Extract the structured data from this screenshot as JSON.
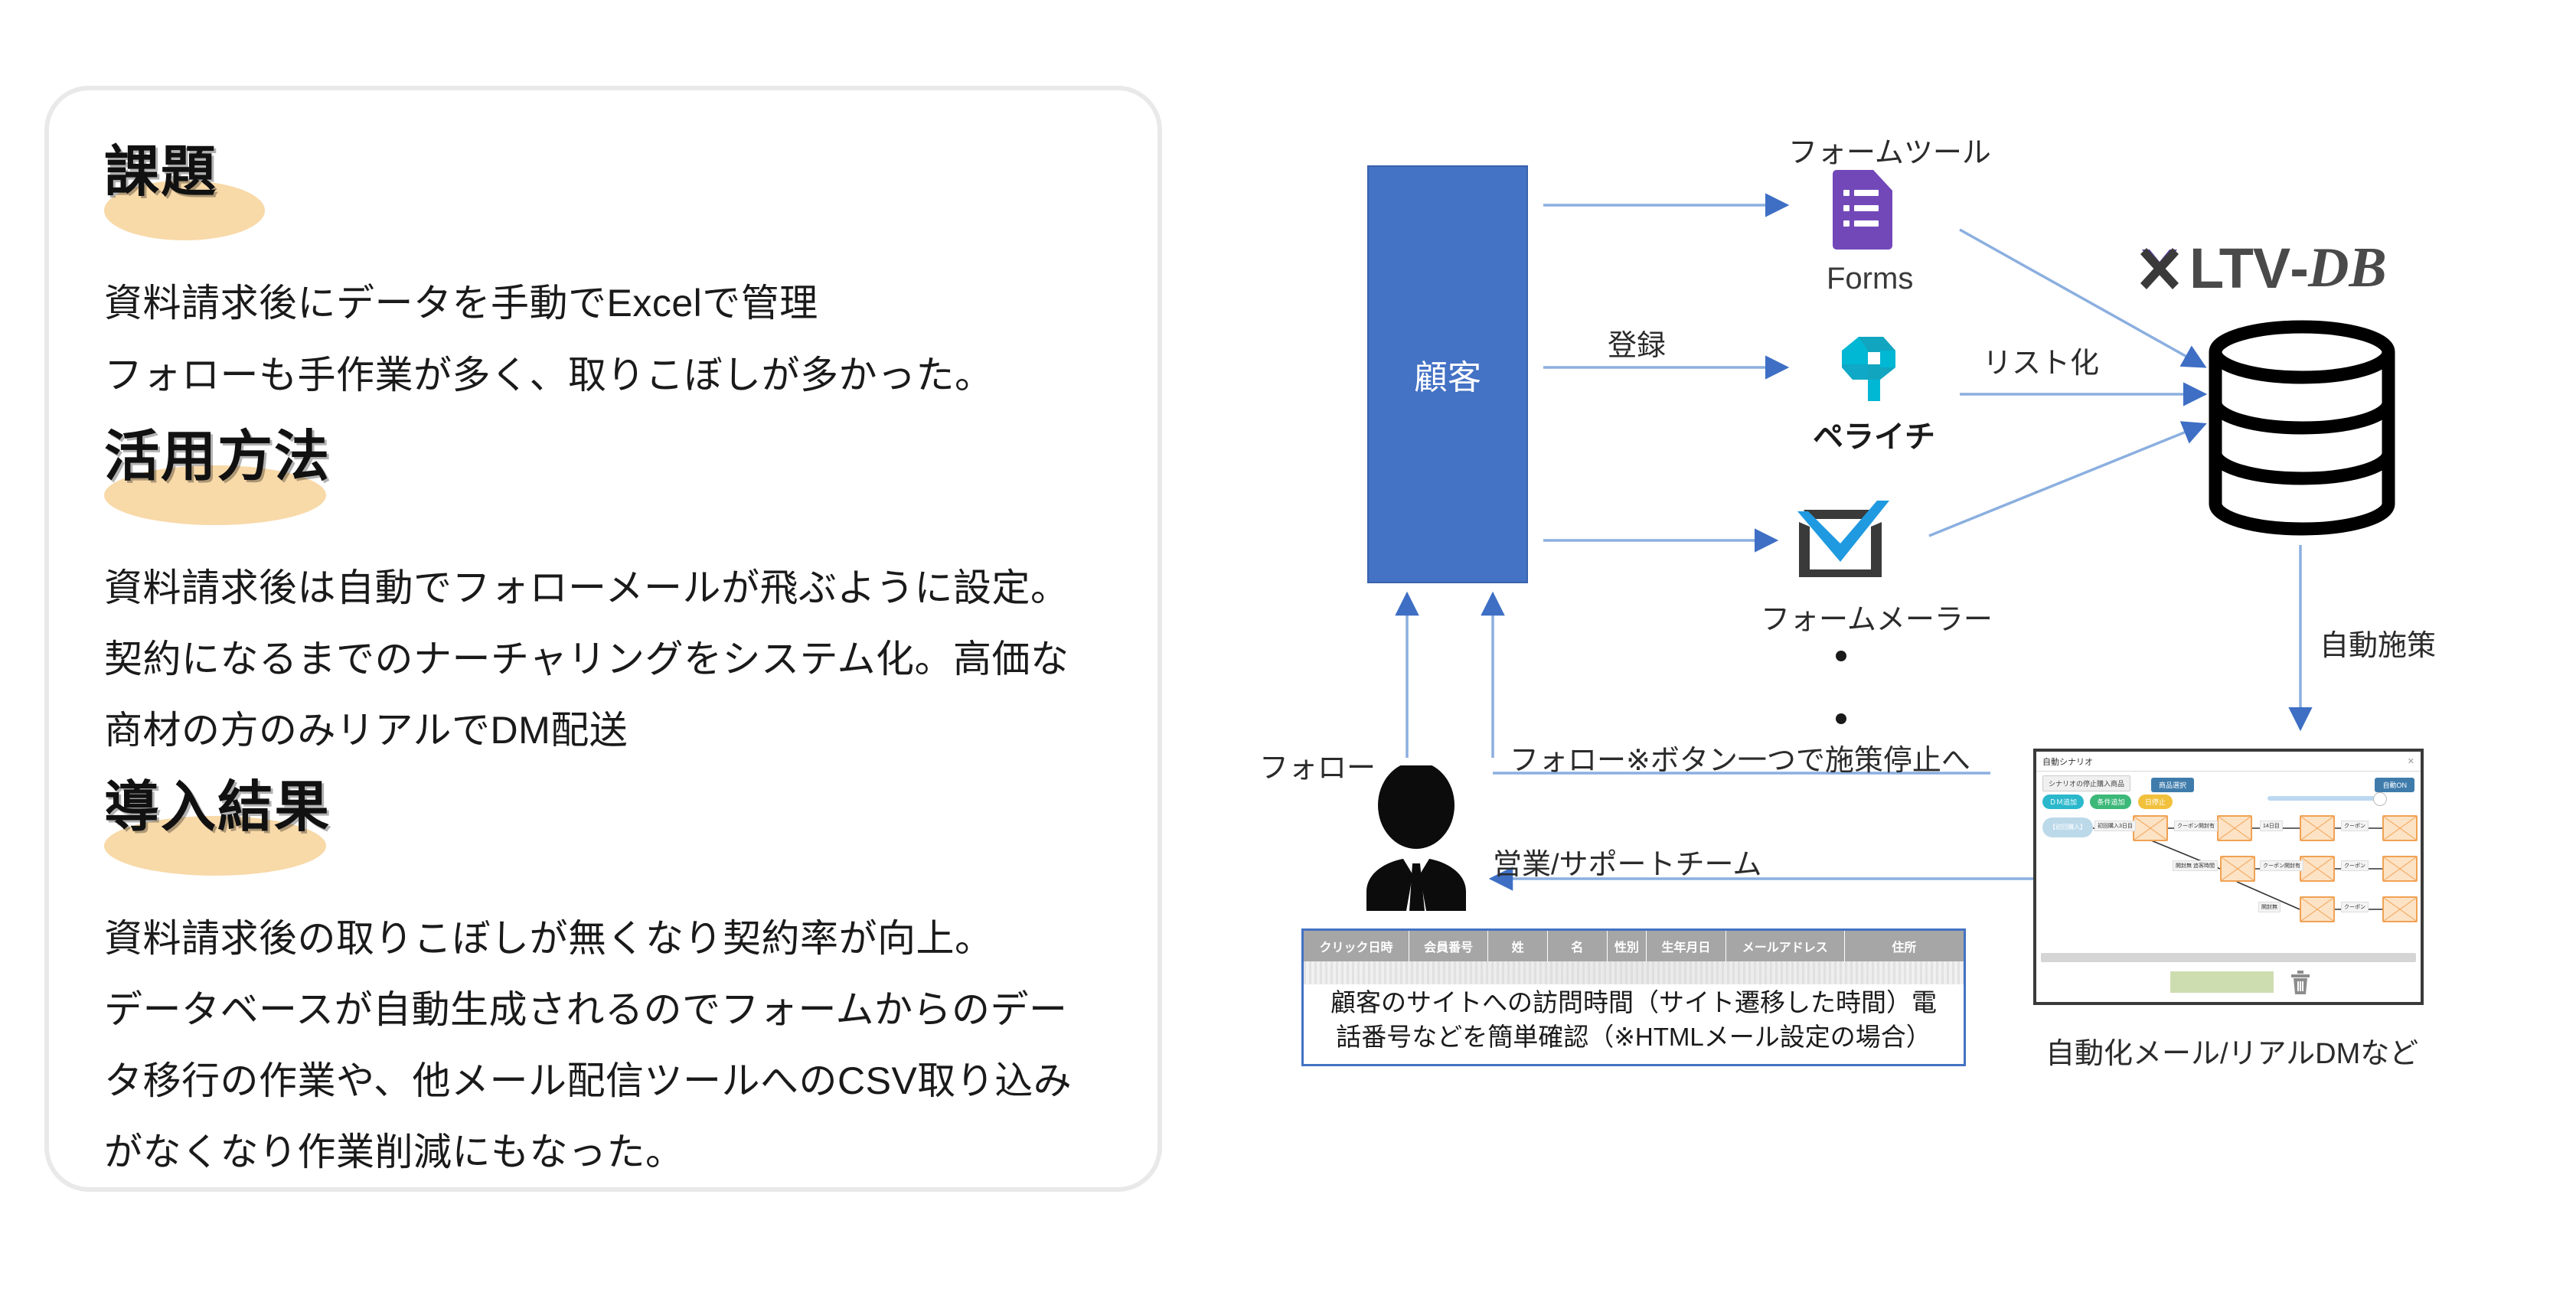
{
  "left_panel": {
    "sections": [
      {
        "heading": "課題",
        "lines": [
          "資料請求後にデータを手動でExcelで管理",
          "フォローも手作業が多く、取りこぼしが多かった。"
        ]
      },
      {
        "heading": "活用方法",
        "lines": [
          "資料請求後は自動でフォローメールが飛ぶように設定。",
          "契約になるまでのナーチャリングをシステム化。高価な",
          "商材の方のみリアルでDM配送"
        ]
      },
      {
        "heading": "導入結果",
        "lines": [
          "資料請求後の取りこぼしが無くなり契約率が向上。",
          "データベースが自動生成されるのでフォームからのデー",
          "タ移行の作業や、他メール配信ツールへのCSV取り込み",
          "がなくなり作業削減にもなった。"
        ]
      }
    ],
    "colors": {
      "highlight": "#f8d9a8",
      "border": "#e9e9ea",
      "text": "#1a1a1a"
    }
  },
  "diagram": {
    "customer_box_label": "顧客",
    "customer_box_color": "#4472c4",
    "arrow_color": "#5b8bd4",
    "labels": {
      "form_tool": "フォームツール",
      "register": "登録",
      "listing": "リスト化",
      "auto_measure": "自動施策",
      "follow_left": "フォロー",
      "follow_stop": "フォロー※ボタン一つで施策停止へ",
      "sales_support_team": "営業/サポートチーム",
      "automation_caption": "自動化メール/リアルDMなど"
    },
    "tools": [
      {
        "name": "Forms",
        "icon": "google-forms-icon",
        "color": "#7248b9"
      },
      {
        "name": "ペライチ",
        "icon": "peraichi-icon",
        "color": "#00b0cc"
      },
      {
        "name": "フォームメーラー",
        "icon": "formmailer-icon",
        "color": "#1f9ae0"
      }
    ],
    "ellipsis_dots": 2,
    "ltvdb": {
      "mark": "x-mark-icon",
      "text_bold": "LTV",
      "text_dash": "-",
      "text_italic": "DB",
      "color": "#4a4a4a",
      "accent": "#5b3e9e"
    },
    "database_icon": "database-cylinder-icon",
    "lead_table": {
      "headers": [
        "クリック日時",
        "会員番号",
        "姓",
        "名",
        "性別",
        "生年月日",
        "メールアドレス",
        "住所"
      ],
      "header_bg": "#a6a6a6",
      "border_color": "#4472c4",
      "caption_line1": "顧客のサイトへの訪問時間（サイト遷移した時間）電",
      "caption_line2": "話番号などを簡単確認（※HTMLメール設定の場合）"
    },
    "scenario_window": {
      "title": "自動シナリオ",
      "close_icon": "close-icon",
      "buttons": {
        "stop_purchase": "シナリオの停止購入商品",
        "product_select": "商品選択",
        "auto_on": "自動ON"
      },
      "pills": [
        {
          "label": "ＤＭ追加",
          "color": "#2bb8cc"
        },
        {
          "label": "条件追加",
          "color": "#3cb878"
        },
        {
          "label": "日停止",
          "color": "#f2c13c"
        }
      ],
      "start_node": "【初回購入】",
      "edge_labels": [
        "初回購入3日目",
        "クーポン開封有",
        "14日目",
        "クーポン",
        "開封無 追客時間",
        "クーポン開封有",
        "クーポン",
        "開封無",
        "クーポン"
      ],
      "envelope_count": 9,
      "trash_icon": "trash-icon",
      "scrollbar": "horizontal-scrollbar"
    }
  }
}
